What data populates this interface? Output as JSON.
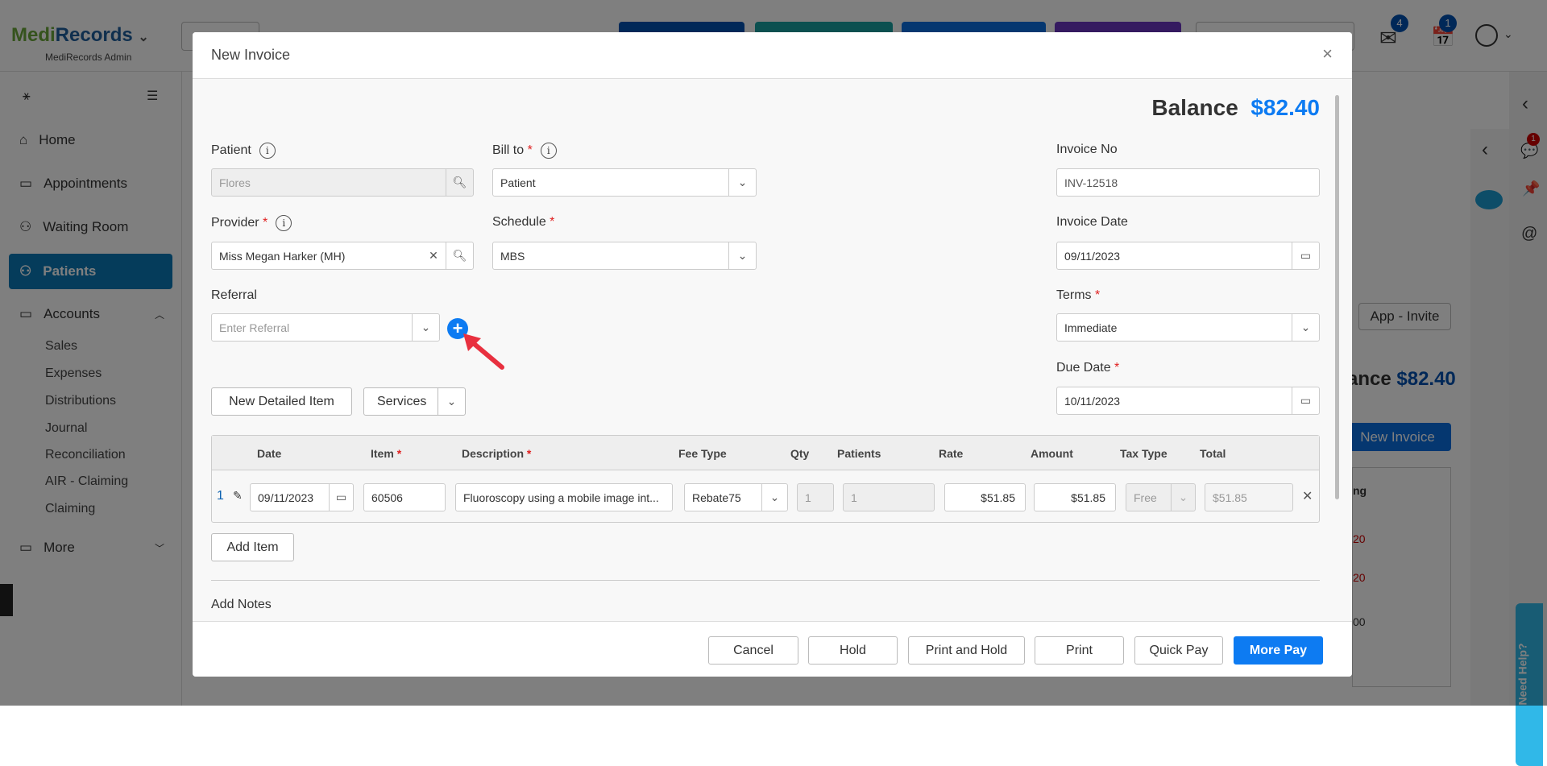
{
  "app": {
    "brand_a": "Medi",
    "brand_b": "Records",
    "subtitle": "MediRecords Admin",
    "mail_badge": "4",
    "tasks_badge": "1",
    "chat_badge": "1"
  },
  "sidebar": {
    "items": [
      {
        "label": "Home"
      },
      {
        "label": "Appointments"
      },
      {
        "label": "Waiting Room"
      },
      {
        "label": "Patients"
      },
      {
        "label": "Accounts"
      }
    ],
    "sub": [
      "Sales",
      "Expenses",
      "Distributions",
      "Journal",
      "Reconciliation",
      "AIR - Claiming",
      "Claiming"
    ],
    "more": "More"
  },
  "background": {
    "app_invite": "App - Invite",
    "balance_partial": "ance",
    "balance_value": "$82.40",
    "new_invoice": "New Invoice",
    "col_partial": "ng",
    "rows": [
      "20",
      "20",
      "00"
    ],
    "need_help": "Need Help?"
  },
  "modal": {
    "title": "New Invoice",
    "balance_label": "Balance",
    "balance_value": "$82.40",
    "patient": {
      "label": "Patient",
      "placeholder": "Flores"
    },
    "bill_to": {
      "label": "Bill to",
      "value": "Patient"
    },
    "invoice_no": {
      "label": "Invoice No",
      "value": "INV-12518"
    },
    "provider": {
      "label": "Provider",
      "value": "Miss Megan Harker (MH)"
    },
    "schedule": {
      "label": "Schedule",
      "value": "MBS"
    },
    "invoice_date": {
      "label": "Invoice Date",
      "value": "09/11/2023"
    },
    "referral": {
      "label": "Referral",
      "placeholder": "Enter Referral"
    },
    "terms": {
      "label": "Terms",
      "value": "Immediate"
    },
    "due_date": {
      "label": "Due Date",
      "value": "10/11/2023"
    },
    "new_detailed_item": "New Detailed Item",
    "services": "Services",
    "table": {
      "headers": [
        "Date",
        "Item",
        "Description",
        "Fee Type",
        "Qty",
        "Patients",
        "Rate",
        "Amount",
        "Tax Type",
        "Total"
      ],
      "rows": [
        {
          "num": "1",
          "date": "09/11/2023",
          "item": "60506",
          "description": "Fluoroscopy using a mobile image int...",
          "fee_type": "Rebate75",
          "qty": "1",
          "patients": "1",
          "rate": "$51.85",
          "amount": "$51.85",
          "tax_type": "Free",
          "total": "$51.85"
        }
      ]
    },
    "add_item": "Add Item",
    "add_notes": "Add Notes",
    "footer": {
      "cancel": "Cancel",
      "hold": "Hold",
      "print_hold": "Print and Hold",
      "print": "Print",
      "quick_pay": "Quick Pay",
      "more_pay": "More Pay"
    }
  },
  "colors": {
    "accent": "#0d7bf2",
    "sidebar_active": "#0a79b6",
    "required": "#e02020"
  }
}
